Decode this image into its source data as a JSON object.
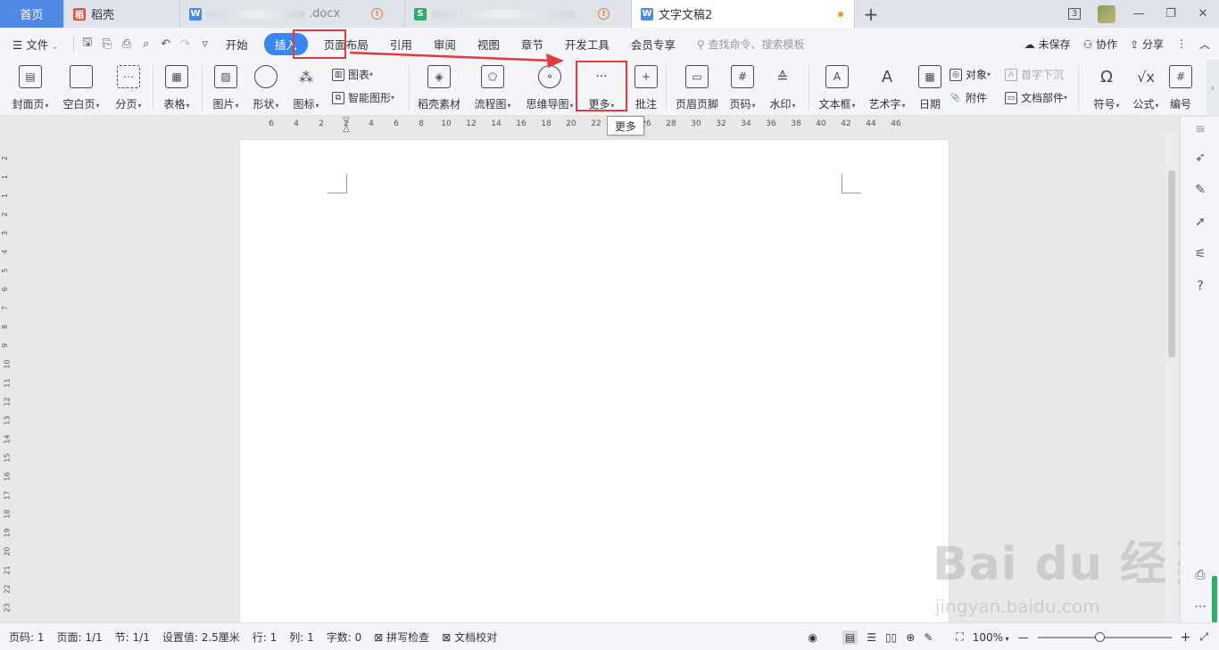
{
  "tabs": {
    "home": "首页",
    "t1": "稻壳",
    "t2_suffix": ".docx",
    "t3_prefix": "",
    "active": "文字文稿2",
    "new_tab": "+"
  },
  "titlebar": {
    "pages_badge": "3"
  },
  "menu": {
    "file": "文件",
    "items": [
      "开始",
      "插入",
      "页面布局",
      "引用",
      "审阅",
      "视图",
      "章节",
      "开发工具",
      "会员专享"
    ],
    "search_placeholder": "查找命令、搜索模板",
    "unsaved": "未保存",
    "collab": "协作",
    "share": "分享"
  },
  "ribbon": {
    "cover": "封面页",
    "blank": "空白页",
    "pagebreak": "分页",
    "table": "表格",
    "picture": "图片",
    "shape": "形状",
    "icons": "图标",
    "chart": "图表",
    "smartart": "智能图形",
    "docer": "稻壳素材",
    "flow": "流程图",
    "mindmap": "思维导图",
    "more": "更多",
    "comment": "批注",
    "header_footer": "页眉页脚",
    "page_no": "页码",
    "watermark": "水印",
    "textbox": "文本框",
    "wordart": "艺术字",
    "date": "日期",
    "object": "对象",
    "attach": "附件",
    "dropcap": "首字下沉",
    "docparts": "文档部件",
    "symbol": "符号",
    "formula": "公式",
    "numbering": "编号"
  },
  "tooltip": "更多",
  "ruler": {
    "h": [
      "6",
      "4",
      "2",
      "2",
      "4",
      "6",
      "8",
      "10",
      "12",
      "14",
      "16",
      "18",
      "20",
      "22",
      "24",
      "26",
      "28",
      "30",
      "32",
      "34",
      "36",
      "38",
      "40",
      "42",
      "44",
      "46"
    ],
    "v": [
      "2",
      "1",
      "1",
      "2",
      "3",
      "4",
      "5",
      "6",
      "7",
      "8",
      "9",
      "10",
      "11",
      "12",
      "13",
      "14",
      "15",
      "16",
      "17",
      "18",
      "19",
      "20",
      "21",
      "22",
      "23"
    ]
  },
  "status": {
    "page": "页码: 1",
    "pages": "页面: 1/1",
    "section": "节: 1/1",
    "setting": "设置值: 2.5厘米",
    "row": "行: 1",
    "col": "列: 1",
    "words": "字数: 0",
    "spell": "拼写检查",
    "proof": "文档校对",
    "zoom": "100%"
  },
  "watermark": {
    "main": "Bai du 经验",
    "sub": "jingyan.baidu.com"
  },
  "colors": {
    "accent": "#3a86f0",
    "home_tab": "#4f89e3",
    "annotation": "#e33b3b"
  }
}
